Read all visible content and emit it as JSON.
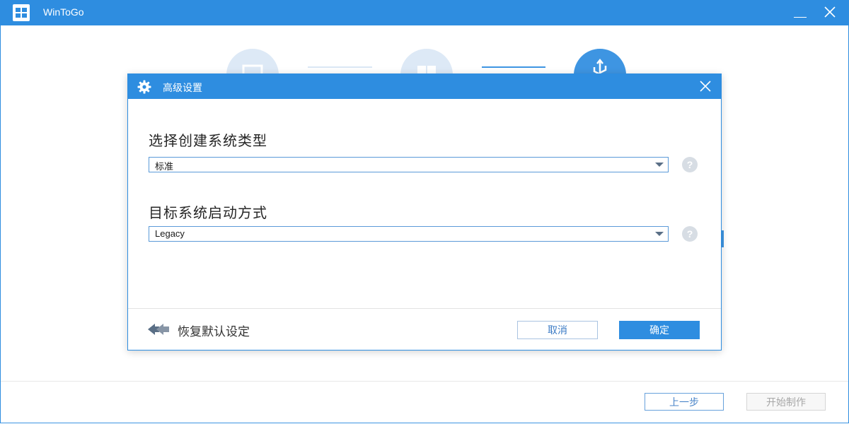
{
  "app": {
    "title": "WinToGo",
    "accent_color": "#2e8de0"
  },
  "icons": {
    "app": "windows-logo-icon",
    "minimize": "minimize-icon",
    "close": "close-icon",
    "gear": "gear-icon",
    "help": "question-icon",
    "reset": "double-left-arrow-icon",
    "dropdown": "chevron-down-icon"
  },
  "steps": [
    {
      "icon": "monitor-icon",
      "state": "inactive"
    },
    {
      "icon": "windows-icon",
      "state": "inactive"
    },
    {
      "icon": "usb-icon",
      "state": "active"
    }
  ],
  "footer": {
    "prev_label": "上一步",
    "start_label": "开始制作"
  },
  "dialog": {
    "title": "高级设置",
    "section1": {
      "label": "选择创建系统类型",
      "value": "标准"
    },
    "section2": {
      "label": "目标系统启动方式",
      "value": "Legacy"
    },
    "help_glyph": "?",
    "reset_label": "恢复默认设定",
    "cancel_label": "取消",
    "ok_label": "确定"
  }
}
